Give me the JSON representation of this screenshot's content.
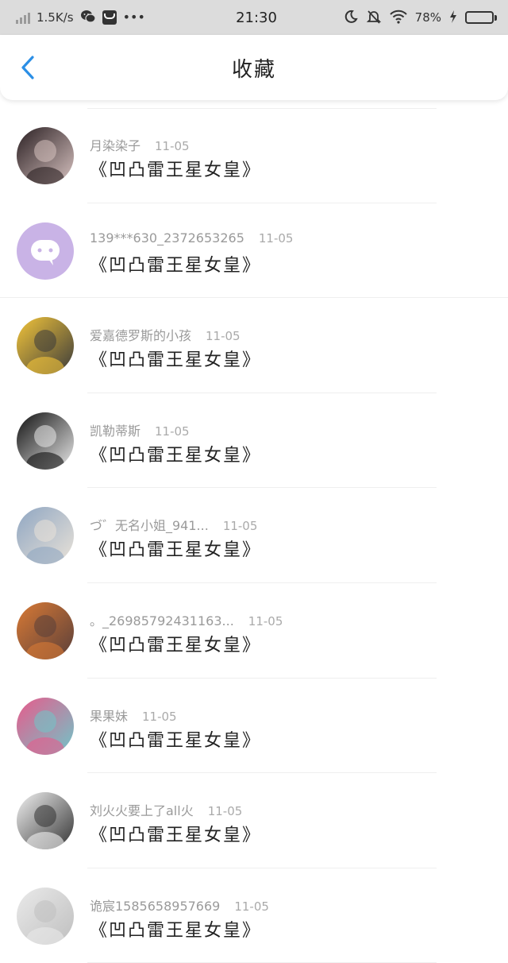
{
  "status_bar": {
    "net_speed": "1.5K/s",
    "time": "21:30",
    "battery_percent": "78%",
    "battery_level": 0.78
  },
  "header": {
    "title": "收藏"
  },
  "items": [
    {
      "user": "月染染子",
      "date": "11-05",
      "text": "《凹凸雷王星女皇》",
      "avatar_colors": [
        "#2a1f22",
        "#d7c2c0"
      ]
    },
    {
      "user": "139***630_2372653265",
      "date": "11-05",
      "text": "《凹凸雷王星女皇》",
      "avatar_colors": [
        "#c9b3e6",
        "#ffffff"
      ]
    },
    {
      "user": "爱嘉德罗斯的小孩",
      "date": "11-05",
      "text": "《凹凸雷王星女皇》",
      "avatar_colors": [
        "#f3c53a",
        "#3b3b3b"
      ]
    },
    {
      "user": "凯勒蒂斯",
      "date": "11-05",
      "text": "《凹凸雷王星女皇》",
      "avatar_colors": [
        "#111111",
        "#e8e8e8"
      ]
    },
    {
      "user": "づ゛无名小姐_941...",
      "date": "11-05",
      "text": "《凹凸雷王星女皇》",
      "avatar_colors": [
        "#8fa6c2",
        "#e9e2d8"
      ]
    },
    {
      "user": "。_26985792431163...",
      "date": "11-05",
      "text": "《凹凸雷王星女皇》",
      "avatar_colors": [
        "#d97a35",
        "#5a3f3a"
      ]
    },
    {
      "user": "果果妹",
      "date": "11-05",
      "text": "《凹凸雷王星女皇》",
      "avatar_colors": [
        "#e85a8b",
        "#6fc6c9"
      ]
    },
    {
      "user": "刘火火要上了all火",
      "date": "11-05",
      "text": "《凹凸雷王星女皇》",
      "avatar_colors": [
        "#f2f2f2",
        "#333333"
      ]
    },
    {
      "user": "诡宸1585658957669",
      "date": "11-05",
      "text": "《凹凸雷王星女皇》",
      "avatar_colors": [
        "#eaeaea",
        "#bfbfbf"
      ]
    }
  ],
  "colors": {
    "accent": "#2b8fe6",
    "status_bg": "#dcdcdc",
    "meta_gray": "#9a9a9a"
  }
}
